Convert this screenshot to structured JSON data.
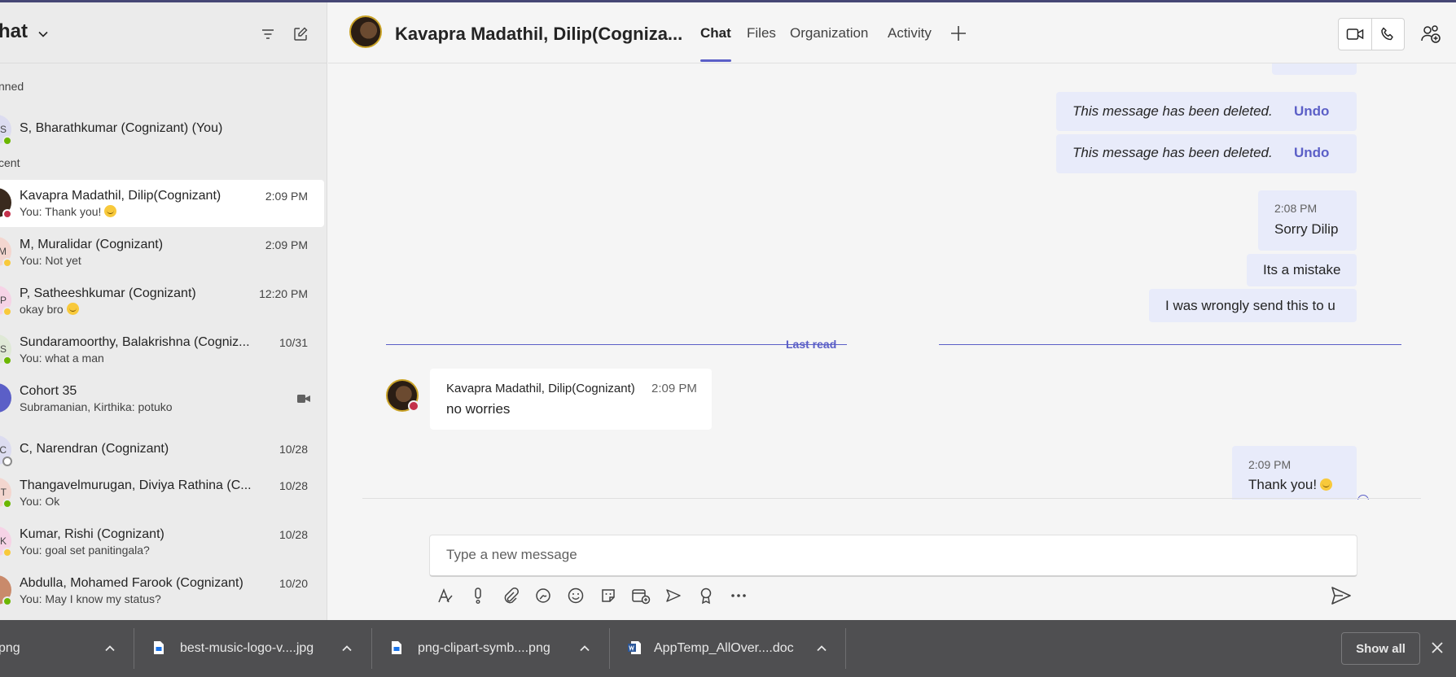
{
  "sidebar": {
    "title": "hat",
    "pinned_label": "nned",
    "recent_label": "cent",
    "pinned": [
      {
        "name": "S, Bharathkumar (Cognizant) (You)",
        "avatar": "S",
        "status_color": "#6bb700",
        "avatar_bg": "#dcdcf0"
      }
    ],
    "recent": [
      {
        "name": "Kavapra Madathil, Dilip(Cognizant)",
        "preview": "You: Thank you!",
        "emoji": true,
        "time": "2:09 PM",
        "avatar": "",
        "status_color": "#c4314b",
        "avatar_bg": "#3a2a1e",
        "active": true
      },
      {
        "name": "M, Muralidar (Cognizant)",
        "preview": "You: Not yet",
        "emoji": false,
        "time": "2:09 PM",
        "avatar": "M",
        "status_color": "#f8c93b",
        "avatar_bg": "#f3d6cf"
      },
      {
        "name": "P, Satheeshkumar (Cognizant)",
        "preview": "okay bro",
        "emoji": true,
        "time": "12:20 PM",
        "avatar": "P",
        "status_color": "#f8c93b",
        "avatar_bg": "#f6d3e6"
      },
      {
        "name": "Sundaramoorthy, Balakrishna (Cogniz...",
        "preview": "You: what a man",
        "emoji": false,
        "time": "10/31",
        "avatar": "S",
        "status_color": "#6bb700",
        "avatar_bg": "#dfe9d6"
      },
      {
        "name": "Cohort 35",
        "preview": "Subramanian, Kirthika: potuko",
        "emoji": false,
        "time": "",
        "avatar": "",
        "status_color": "",
        "avatar_bg": "#5b5fc7",
        "meeting_icon": "video-camera-icon"
      },
      {
        "name": "C, Narendran (Cognizant)",
        "preview": "",
        "emoji": false,
        "time": "10/28",
        "avatar": "C",
        "status_color": "#ffffff",
        "avatar_bg": "#dcdcf0"
      },
      {
        "name": "Thangavelmurugan, Diviya Rathina (C...",
        "preview": "You: Ok",
        "emoji": false,
        "time": "10/28",
        "avatar": "T",
        "status_color": "#6bb700",
        "avatar_bg": "#f3d6cf"
      },
      {
        "name": "Kumar, Rishi (Cognizant)",
        "preview": "You: goal set panitingala?",
        "emoji": false,
        "time": "10/28",
        "avatar": "K",
        "status_color": "#f8c93b",
        "avatar_bg": "#f6d3e6"
      },
      {
        "name": "Abdulla, Mohamed Farook (Cognizant)",
        "preview": "You: May I know my status?",
        "emoji": false,
        "time": "10/20",
        "avatar": "",
        "status_color": "#6bb700",
        "avatar_bg": "#c98a6b"
      }
    ]
  },
  "header": {
    "contact_name": "Kavapra Madathil, Dilip(Cogniza...",
    "tabs": [
      "Chat",
      "Files",
      "Organization",
      "Activity"
    ],
    "active_tab": "Chat"
  },
  "messages": {
    "deleted_text": "This message has been deleted.",
    "undo_label": "Undo",
    "out1_time": "2:08 PM",
    "out1_text": "Sorry Dilip",
    "out2_text": "Its a mistake",
    "out3_text": "I was wrongly send this to u",
    "last_read": "Last read",
    "in_sender": "Kavapra Madathil, Dilip(Cognizant)",
    "in_time": "2:09 PM",
    "in_text": "no worries",
    "out4_time": "2:09 PM",
    "out4_text": "Thank you!"
  },
  "compose": {
    "placeholder": "Type a new message",
    "tools": [
      "format-icon",
      "important-icon",
      "attach-icon",
      "loop-icon",
      "emoji-icon",
      "sticker-icon",
      "schedule-meeting-icon",
      "stream-icon",
      "praise-icon",
      "more-options-icon"
    ]
  },
  "downloads": {
    "items": [
      {
        "name": "png",
        "type": "image"
      },
      {
        "name": "best-music-logo-v....jpg",
        "type": "image"
      },
      {
        "name": "png-clipart-symb....png",
        "type": "image"
      },
      {
        "name": "AppTemp_AllOver....doc",
        "type": "word"
      }
    ],
    "show_all": "Show all"
  },
  "colors": {
    "accent": "#5b5fc7",
    "bubble_out": "#e8ebfa",
    "available": "#6bb700",
    "busy": "#c4314b",
    "away": "#f8c93b"
  }
}
